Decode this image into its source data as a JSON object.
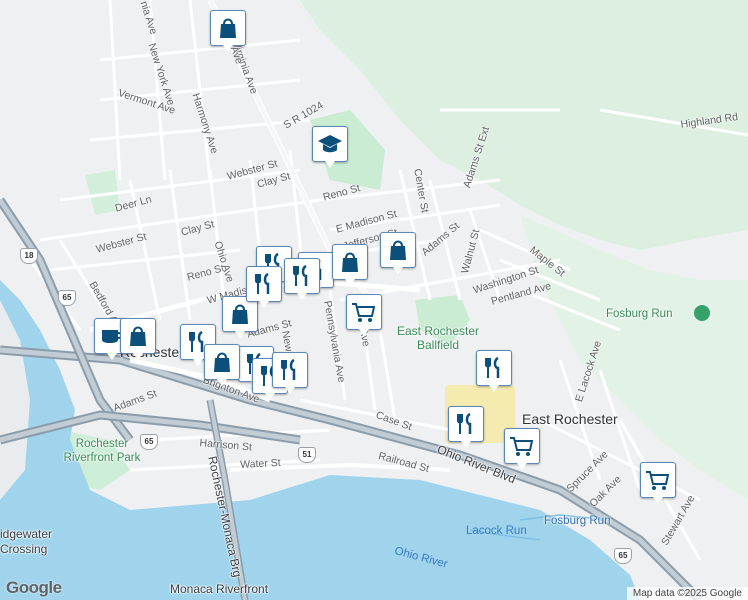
{
  "map": {
    "streets": [
      {
        "name": "Virginia Ave",
        "key": "virginia"
      },
      {
        "name": "S R 1024",
        "key": "sr1024"
      },
      {
        "name": "New York Ave",
        "key": "newyork"
      },
      {
        "name": "Vermont Ave",
        "key": "vermont"
      },
      {
        "name": "Harmony Ave",
        "key": "harmony"
      },
      {
        "name": "Webster St",
        "key": "webster1"
      },
      {
        "name": "Webster St",
        "key": "webster2"
      },
      {
        "name": "Clay St",
        "key": "clay1"
      },
      {
        "name": "Clay St",
        "key": "clay2"
      },
      {
        "name": "Deer Ln",
        "key": "deer"
      },
      {
        "name": "Reno St",
        "key": "reno1"
      },
      {
        "name": "Reno St",
        "key": "reno2"
      },
      {
        "name": "Ohio Ave",
        "key": "ohioave"
      },
      {
        "name": "E Madison St",
        "key": "emadison"
      },
      {
        "name": "Jefferson St",
        "key": "jefferson"
      },
      {
        "name": "W Madison",
        "key": "wmadison"
      },
      {
        "name": "Bedford Ave",
        "key": "bedford"
      },
      {
        "name": "Adams St",
        "key": "adams1"
      },
      {
        "name": "Adams St",
        "key": "adams2"
      },
      {
        "name": "Adams St",
        "key": "adams3"
      },
      {
        "name": "Adams St Ext",
        "key": "adamsext"
      },
      {
        "name": "Center St",
        "key": "center"
      },
      {
        "name": "Walnut St",
        "key": "walnut"
      },
      {
        "name": "Washington St",
        "key": "washington"
      },
      {
        "name": "Maple St",
        "key": "maple"
      },
      {
        "name": "Pentland Ave",
        "key": "pentland"
      },
      {
        "name": "Pennsylvania Ave",
        "key": "pennsylvania"
      },
      {
        "name": "Brighton Ave",
        "key": "brighton"
      },
      {
        "name": "Harrison St",
        "key": "harrison"
      },
      {
        "name": "Water St",
        "key": "water"
      },
      {
        "name": "Case St",
        "key": "case"
      },
      {
        "name": "Railroad St",
        "key": "railroad"
      },
      {
        "name": "Ohio River Blvd",
        "key": "ohioriverblvd"
      },
      {
        "name": "Rochester-Monaca Brg",
        "key": "brg"
      },
      {
        "name": "Highland Rd",
        "key": "highland"
      },
      {
        "name": "E Lacock Ave",
        "key": "elacock"
      },
      {
        "name": "Spruce Ave",
        "key": "spruce"
      },
      {
        "name": "Oak Ave",
        "key": "oak"
      },
      {
        "name": "Stewart Ave",
        "key": "stewart"
      },
      {
        "name": "New",
        "key": "newst"
      },
      {
        "name": "Ave",
        "key": "ave"
      },
      {
        "name": "Ave",
        "key": "ave2"
      },
      {
        "name": "nia Ave",
        "key": "niaave"
      }
    ],
    "places": {
      "east_rochester": "East Rochester",
      "rochester": "Rochester",
      "ballfield": "East Rochester Ballfield",
      "riverfront_park": "Rochester Riverfront Park",
      "fosburg_run_park": "Fosburg Run",
      "fosburg_run_stream": "Fosburg Run",
      "lacock_run": "Lacock Run",
      "ohio_river": "Ohio River",
      "bridgewater": "idgewater Crossing",
      "monaca": "Monaca Riverfront"
    },
    "shields": [
      "18",
      "65",
      "65",
      "51",
      "65"
    ],
    "pins": [
      {
        "type": "shopping-bag-icon"
      },
      {
        "type": "school-icon"
      },
      {
        "type": "restaurant-icon"
      },
      {
        "type": "restaurant-icon"
      },
      {
        "type": "restaurant-icon"
      },
      {
        "type": "shopping-bag-icon"
      },
      {
        "type": "shopping-bag-icon"
      },
      {
        "type": "grocery-cart-icon"
      },
      {
        "type": "cafe-icon"
      },
      {
        "type": "shopping-bag-icon"
      },
      {
        "type": "restaurant-icon"
      },
      {
        "type": "shopping-bag-icon"
      },
      {
        "type": "restaurant-icon"
      },
      {
        "type": "restaurant-icon"
      },
      {
        "type": "restaurant-icon"
      },
      {
        "type": "restaurant-icon"
      },
      {
        "type": "grocery-cart-icon"
      },
      {
        "type": "grocery-cart-icon"
      }
    ],
    "logo": "Google",
    "attribution": "Map data ©2025 Google",
    "colors": {
      "water": "#9fd4ec",
      "park": "#c9ecd3",
      "pin_icon": "#0b4f7a",
      "highway": "#8b9cab"
    }
  }
}
